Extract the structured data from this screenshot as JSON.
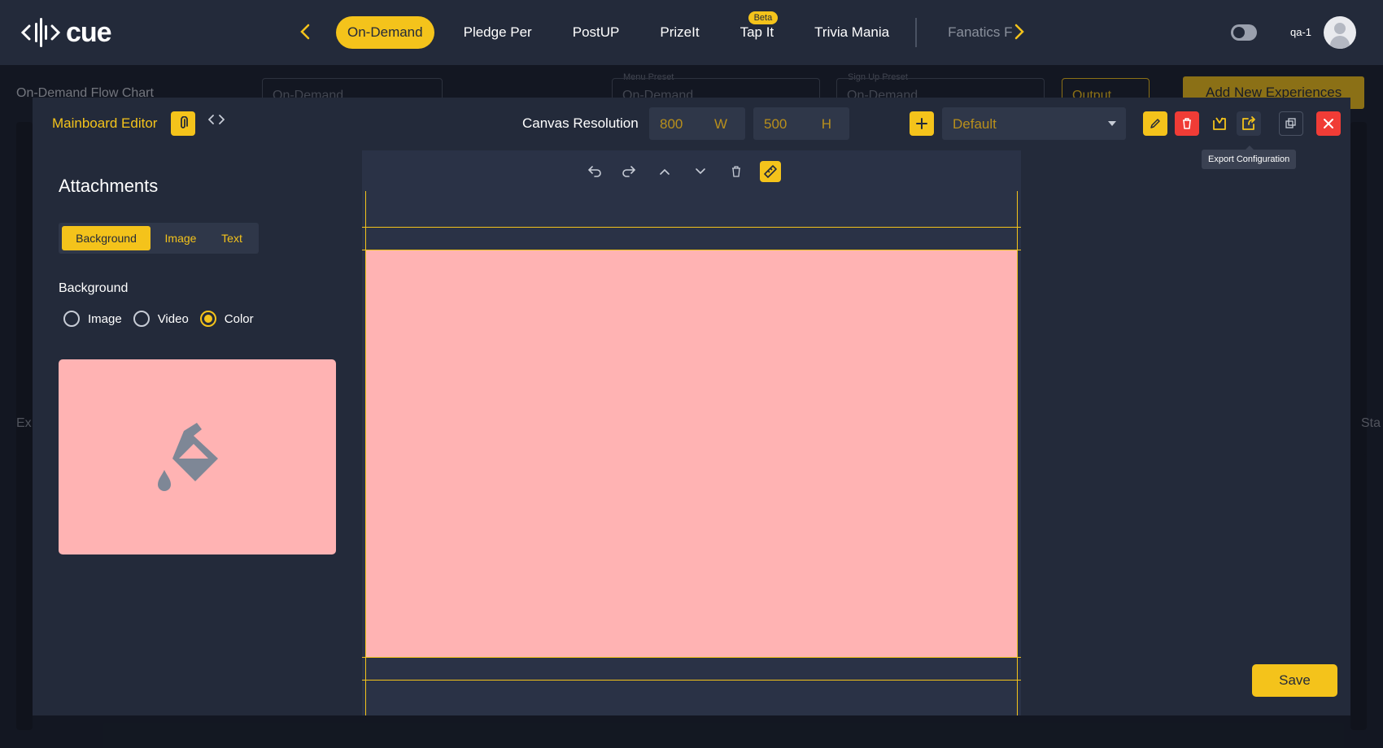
{
  "app": {
    "logo_text": "cue"
  },
  "nav": {
    "tabs": [
      "On-Demand",
      "Pledge Per",
      "PostUP",
      "PrizeIt",
      "Tap It",
      "Trivia Mania",
      "Fanatics F"
    ],
    "active_tab": "On-Demand",
    "beta_badge": "Beta",
    "user": "qa-1"
  },
  "background": {
    "title": "On-Demand Flow Chart",
    "select_value": "On-Demand",
    "menu_preset_label": "Menu Preset",
    "menu_preset_value": "On-Demand",
    "signup_preset_label": "Sign Up Preset",
    "signup_preset_value": "On-Demand",
    "output_label": "Output",
    "add_button": "Add New Experiences",
    "section_left": "Ex",
    "section_right": "Sta"
  },
  "modal": {
    "title": "Mainboard Editor",
    "canvas_resolution_label": "Canvas Resolution",
    "width_value": "800",
    "width_unit": "W",
    "height_value": "500",
    "height_unit": "H",
    "preset_value": "Default",
    "tooltip": "Export Configuration",
    "save_label": "Save"
  },
  "attachments": {
    "title": "Attachments",
    "tabs": [
      "Background",
      "Image",
      "Text"
    ],
    "active_tab": "Background",
    "background_heading": "Background",
    "options": [
      "Image",
      "Video",
      "Color"
    ],
    "selected_option": "Color",
    "color": "#ffb3b3"
  },
  "colors": {
    "accent": "#f4c31b",
    "danger": "#f03c36",
    "canvas_background": "#ffb3b3",
    "nav_background": "#232a3a"
  }
}
